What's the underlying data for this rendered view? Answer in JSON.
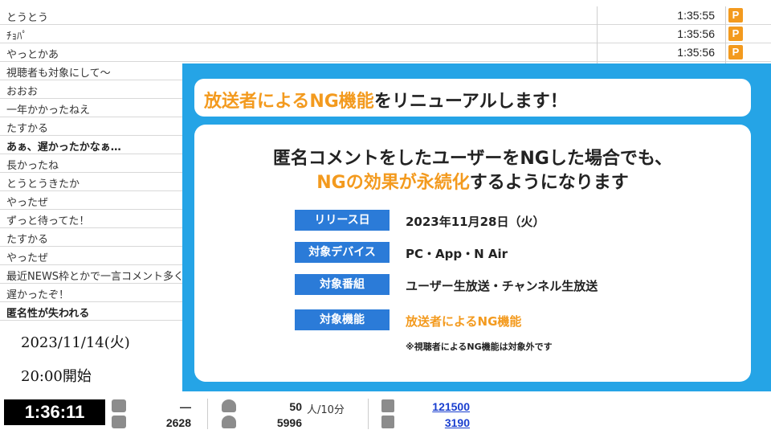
{
  "comments": [
    {
      "text": "とうとう",
      "time": "1:35:55",
      "badge": "P",
      "bold": false
    },
    {
      "text": "ﾁｮﾊﾟ",
      "time": "1:35:56",
      "badge": "P",
      "bold": false
    },
    {
      "text": "やっとかあ",
      "time": "1:35:56",
      "badge": "P",
      "bold": false
    },
    {
      "text": "視聴者も対象にして～",
      "time": "",
      "badge": "",
      "bold": false
    },
    {
      "text": "おおお",
      "time": "",
      "badge": "",
      "bold": false
    },
    {
      "text": "一年かかったねえ",
      "time": "",
      "badge": "",
      "bold": false
    },
    {
      "text": "たすかる",
      "time": "",
      "badge": "",
      "bold": false
    },
    {
      "text": "あぁ、遅かったかなぁ…",
      "time": "",
      "badge": "",
      "bold": true
    },
    {
      "text": "長かったね",
      "time": "",
      "badge": "",
      "bold": false
    },
    {
      "text": "とうとうきたか",
      "time": "",
      "badge": "",
      "bold": false
    },
    {
      "text": "やったぜ",
      "time": "",
      "badge": "",
      "bold": false
    },
    {
      "text": "ずっと待ってた！",
      "time": "",
      "badge": "",
      "bold": false
    },
    {
      "text": "たすかる",
      "time": "",
      "badge": "",
      "bold": false
    },
    {
      "text": "やったぜ",
      "time": "",
      "badge": "",
      "bold": false
    },
    {
      "text": "最近NEWS枠とかで一言コメント多く",
      "time": "",
      "badge": "",
      "bold": false
    },
    {
      "text": "遅かったぞ！",
      "time": "",
      "badge": "",
      "bold": false
    },
    {
      "text": "匿名性が失われる",
      "time": "",
      "badge": "",
      "bold": true
    }
  ],
  "date_line": "2023/11/14(火)",
  "start_line": "20:00開始",
  "overlay": {
    "title_highlight": "放送者によるNG機能",
    "title_rest": "をリニューアルします！",
    "headline1": "匿名コメントをしたユーザーをNGした場合でも、",
    "headline2_highlight": "NGの効果が永続化",
    "headline2_rest": "するようになります",
    "details": [
      {
        "label": "リリース日",
        "value": "2023年11月28日（火）",
        "highlight": false
      },
      {
        "label": "対象デバイス",
        "value": "PC・App・N Air",
        "highlight": false
      },
      {
        "label": "対象番組",
        "value": "ユーザー生放送・チャンネル生放送",
        "highlight": false
      },
      {
        "label": "対象機能",
        "value": "放送者によるNG機能",
        "highlight": true
      }
    ],
    "note": "※視聴者によるNG機能は対象外です"
  },
  "status": {
    "clock": "1:36:11",
    "comment_top": "—",
    "comment_count": "2628",
    "viewers_rate": "50",
    "viewers_rate_unit": "人/10分",
    "viewers_total": "5996",
    "ad_points": "121500",
    "gift_points": "3190"
  },
  "colors": {
    "accent_blue": "#25a4e6",
    "label_blue": "#2b7bd8",
    "orange": "#f39a1e"
  }
}
